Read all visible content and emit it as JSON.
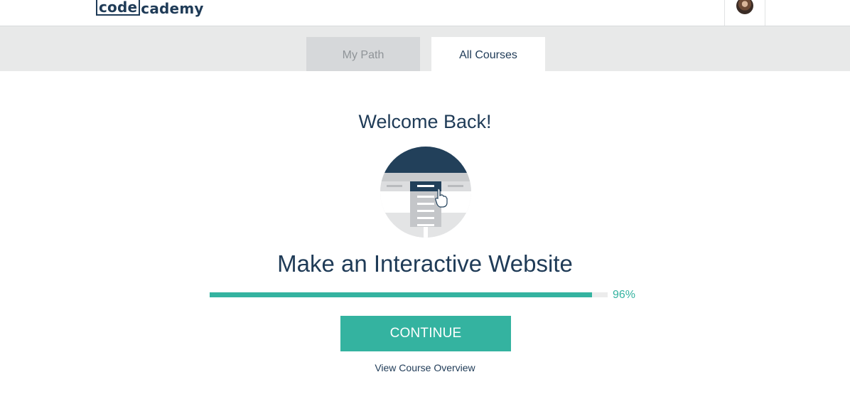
{
  "header": {
    "logo_part1": "code",
    "logo_part2": "cademy",
    "avatar_icon": "user-avatar"
  },
  "tabs": [
    {
      "label": "My Path",
      "active": false
    },
    {
      "label": "All Courses",
      "active": true
    }
  ],
  "main": {
    "welcome": "Welcome Back!",
    "illustration_icon": "webpage-click-illustration",
    "course_title": "Make an Interactive Website",
    "progress_percent": 96,
    "progress_label": "96%",
    "continue_label": "CONTINUE",
    "overview_label": "View Course Overview"
  },
  "colors": {
    "brand_navy": "#1f3b57",
    "accent_teal": "#34b3a0",
    "tab_band": "#e8e9e9",
    "inactive_tab": "#d6d8da"
  }
}
